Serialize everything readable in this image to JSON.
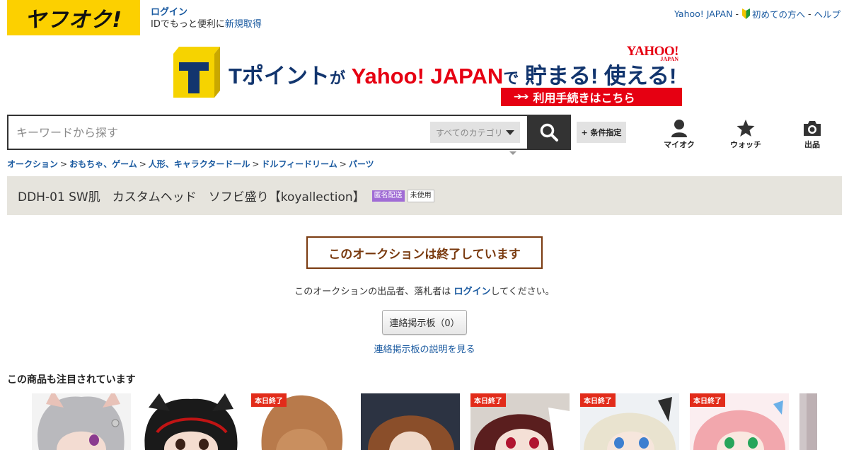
{
  "header": {
    "logo_text": "ヤフオク!",
    "login_label": "ログイン",
    "login_sub_prefix": "IDでもっと便利に",
    "signup_label": "新規取得",
    "top_links": {
      "yahoo_japan": "Yahoo! JAPAN",
      "sep1": "-",
      "beginner": "初めての方へ",
      "sep2": "-",
      "help": "ヘルプ"
    }
  },
  "banner": {
    "line_part1": "Tポイント",
    "line_part2": "が",
    "line_part3": "Yahoo! JAPAN",
    "line_part4": "で",
    "line_part5": "貯まる! 使える!",
    "yahoo_logo": "YAHOO!",
    "yahoo_logo_sub": "JAPAN",
    "cta": "利用手続きはこちら",
    "cta_arrows": "➔➔"
  },
  "search": {
    "placeholder": "キーワードから探す",
    "category": "すべてのカテゴリ",
    "conditions_label": "+ 条件指定"
  },
  "nav": {
    "myauc": "マイオク",
    "watch": "ウォッチ",
    "sell": "出品"
  },
  "breadcrumb": [
    "オークション",
    "おもちゃ、ゲーム",
    "人形、キャラクタードール",
    "ドルフィードリーム",
    "パーツ"
  ],
  "breadcrumb_sep": ">",
  "item": {
    "title": "DDH-01 SW肌　カスタムヘッド　ソフビ盛り【koyallection】",
    "badge_anonymous": "匿名配送",
    "badge_condition": "未使用"
  },
  "ended": {
    "message": "このオークションは終了しています",
    "note_prefix": "このオークションの出品者、落札者は ",
    "note_link": "ログイン",
    "note_suffix": "してください。",
    "board_button": "連絡掲示板（0）",
    "board_help": "連絡掲示板の説明を見る"
  },
  "recommendations": {
    "title": "この商品も注目されています",
    "ending_badge": "本日終了",
    "items": [
      {
        "ending": false
      },
      {
        "ending": false
      },
      {
        "ending": true
      },
      {
        "ending": false
      },
      {
        "ending": true
      },
      {
        "ending": true
      },
      {
        "ending": true
      },
      {
        "ending": false
      }
    ]
  },
  "colors": {
    "logo_yellow": "#fcd000",
    "link_blue": "#1a5aa0",
    "ended_brown": "#7a3b10",
    "badge_purple": "#a06cd5",
    "ending_red": "#e22c1a",
    "tpoint_red": "#e60012",
    "tpoint_navy": "#12356e"
  }
}
